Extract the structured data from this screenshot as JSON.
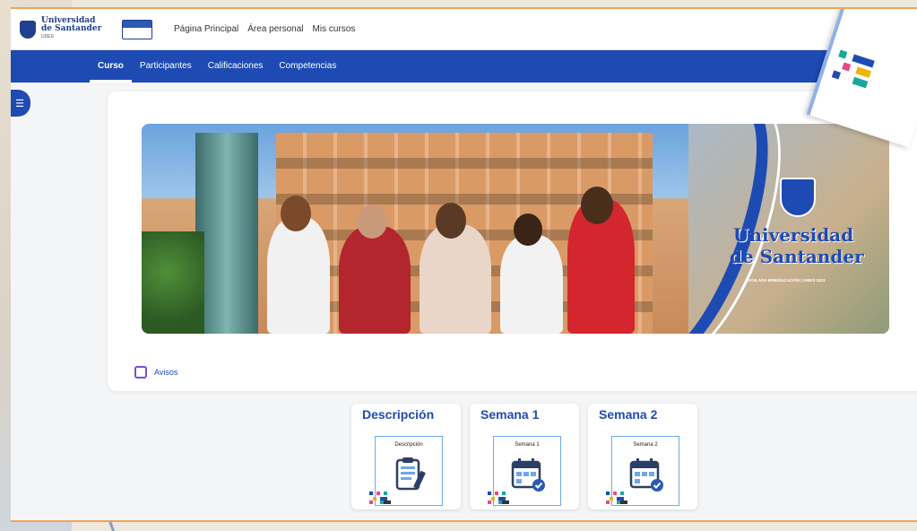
{
  "header": {
    "logo_line1": "Universidad",
    "logo_line2": "de Santander",
    "logo_line3": "UDES",
    "nav": [
      "Página Principal",
      "Área personal",
      "Mis cursos"
    ]
  },
  "course_nav": {
    "tabs": [
      {
        "label": "Curso",
        "active": true
      },
      {
        "label": "Participantes",
        "active": false
      },
      {
        "label": "Calificaciones",
        "active": false
      },
      {
        "label": "Competencias",
        "active": false
      }
    ]
  },
  "banner": {
    "brand_line1": "Universidad",
    "brand_line2": "de Santander",
    "tagline": "VIGILADA MINEDUCACIÓN | SNIES 2832"
  },
  "avisos": {
    "label": "Avisos"
  },
  "sections": [
    {
      "title": "Descripción",
      "caption": "Descripción",
      "icon": "clipboard-icon"
    },
    {
      "title": "Semana 1",
      "caption": "Semana 1",
      "icon": "calendar-check-icon"
    },
    {
      "title": "Semana 2",
      "caption": "Semana 2",
      "icon": "calendar-check-icon"
    }
  ],
  "colors": {
    "primary": "#1e4bb3",
    "accent_border": "#f0a35a",
    "tile_border": "#6fa7e8"
  }
}
